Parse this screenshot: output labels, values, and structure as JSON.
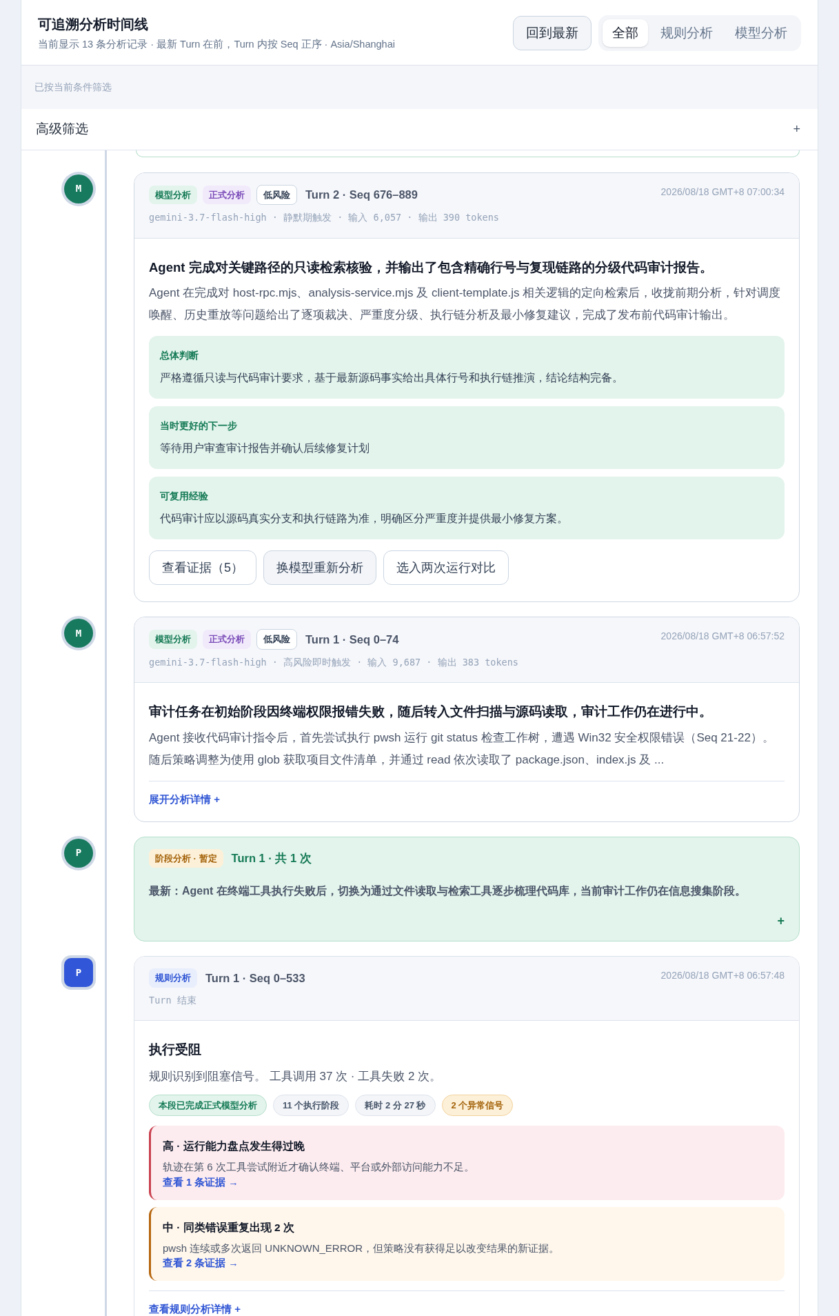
{
  "header": {
    "title": "可追溯分析时间线",
    "subtitle": "当前显示 13 条分析记录 · 最新 Turn 在前，Turn 内按 Seq 正序 · Asia/Shanghai",
    "back_button": "回到最新",
    "tabs": [
      {
        "label": "全部",
        "selected": true
      },
      {
        "label": "规则分析",
        "selected": false
      },
      {
        "label": "模型分析",
        "selected": false
      }
    ]
  },
  "filter_note": "已按当前条件筛选",
  "advanced_filter": {
    "label": "高级筛选",
    "toggle": "+"
  },
  "timeline": [
    {
      "kind": "model",
      "node": "M",
      "tags": [
        {
          "label": "模型分析",
          "kind": "model"
        },
        {
          "label": "正式分析",
          "kind": "formal"
        },
        {
          "label": "低风险",
          "kind": "risk"
        }
      ],
      "turn": "Turn 2 · Seq 676–889",
      "timestamp": "2026/08/18 GMT+8 07:00:34",
      "meta": "gemini-3.7-flash-high · 静默期触发 · 输入 6,057 · 输出 390 tokens",
      "headline": "Agent 完成对关键路径的只读检索核验，并输出了包含精确行号与复现链路的分级代码审计报告。",
      "summary": "Agent 在完成对 host-rpc.mjs、analysis-service.mjs 及 client-template.js 相关逻辑的定向检索后，收拢前期分析，针对调度唤醒、历史重放等问题给出了逐项裁决、严重度分级、执行链分析及最小修复建议，完成了发布前代码审计输出。",
      "sections": [
        {
          "title": "总体判断",
          "text": "严格遵循只读与代码审计要求，基于最新源码事实给出具体行号和执行链推演，结论结构完备。"
        },
        {
          "title": "当时更好的下一步",
          "text": "等待用户审查审计报告并确认后续修复计划"
        },
        {
          "title": "可复用经验",
          "text": "代码审计应以源码真实分支和执行链路为准，明确区分严重度并提供最小修复方案。"
        }
      ],
      "actions": [
        {
          "label": "查看证据（5）",
          "selected": false
        },
        {
          "label": "换模型重新分析",
          "selected": true
        },
        {
          "label": "选入两次运行对比",
          "selected": false
        }
      ]
    },
    {
      "kind": "model",
      "node": "M",
      "tags": [
        {
          "label": "模型分析",
          "kind": "model"
        },
        {
          "label": "正式分析",
          "kind": "formal"
        },
        {
          "label": "低风险",
          "kind": "risk"
        }
      ],
      "turn": "Turn 1 · Seq 0–74",
      "timestamp": "2026/08/18 GMT+8 06:57:52",
      "meta": "gemini-3.7-flash-high · 高风险即时触发 · 输入 9,687 · 输出 383 tokens",
      "headline": "审计任务在初始阶段因终端权限报错失败，随后转入文件扫描与源码读取，审计工作仍在进行中。",
      "summary": "Agent 接收代码审计指令后，首先尝试执行 pwsh 运行 git status 检查工作树，遭遇 Win32 安全权限错误（Seq 21-22）。随后策略调整为使用 glob 获取项目文件清单，并通过 read 依次读取了 package.json、index.js 及 ...",
      "expand_link": "展开分析详情 +"
    },
    {
      "kind": "phase",
      "node": "P",
      "tags": [
        {
          "label": "阶段分析 · 暂定",
          "kind": "phase"
        }
      ],
      "turn": "Turn 1 · 共 1 次",
      "latest": "最新：Agent 在终端工具执行失败后，切换为通过文件读取与检索工具逐步梳理代码库，当前审计工作仍在信息搜集阶段。",
      "toggle": "+"
    },
    {
      "kind": "rule",
      "node": "P",
      "tags": [
        {
          "label": "规则分析",
          "kind": "rule"
        }
      ],
      "turn": "Turn 1 · Seq 0–533",
      "timestamp": "2026/08/18 GMT+8 06:57:48",
      "meta": "Turn 结束",
      "headline": "执行受阻",
      "summary": "规则识别到阻塞信号。 工具调用 37 次 · 工具失败 2 次。",
      "chips": [
        {
          "label": "本段已完成正式模型分析",
          "kind": "success"
        },
        {
          "label": "11 个执行阶段",
          "kind": "neutral"
        },
        {
          "label": "耗时 2 分 27 秒",
          "kind": "neutral"
        },
        {
          "label": "2 个异常信号",
          "kind": "warning"
        }
      ],
      "alerts": [
        {
          "kind": "high",
          "title": "高 · 运行能力盘点发生得过晚",
          "text": "轨迹在第 6 次工具尝试附近才确认终端、平台或外部访问能力不足。",
          "link": "查看 1 条证据 →"
        },
        {
          "kind": "medium",
          "title": "中 · 同类错误重复出现 2 次",
          "text": "pwsh 连续或多次返回 UNKNOWN_ERROR，但策略没有获得足以改变结果的新证据。",
          "link": "查看 2 条证据 →"
        }
      ],
      "expand_link": "查看规则分析详情 +"
    }
  ]
}
